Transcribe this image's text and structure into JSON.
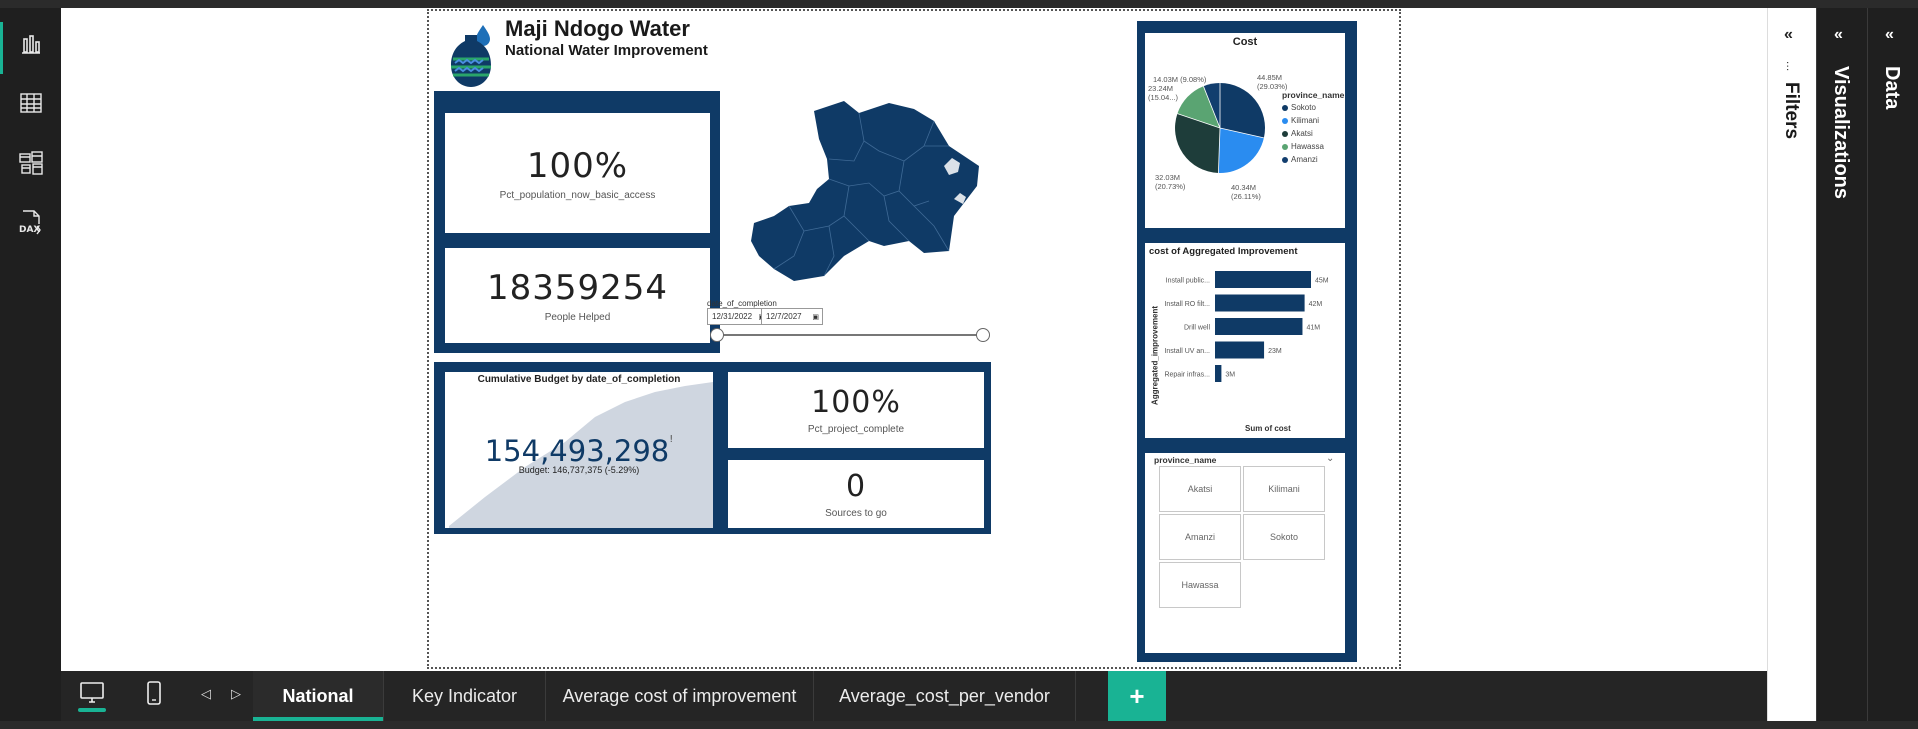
{
  "report": {
    "title": "Maji Ndogo Water",
    "subtitle": "National Water Improvement"
  },
  "kpis": {
    "pct_population": {
      "value": "100%",
      "label": "Pct_population_now_basic_access"
    },
    "people_helped": {
      "value": "18359254",
      "label": "People Helped"
    },
    "pct_project": {
      "value": "100%",
      "label": "Pct_project_complete"
    },
    "sources_to_go": {
      "value": "0",
      "label": "Sources to go"
    }
  },
  "date_slicer": {
    "label": "date_of_completion",
    "start": "12/31/2022",
    "end": "12/7/2027"
  },
  "cumulative": {
    "title": "Cumulative Budget by date_of_completion",
    "value": "154,493,298",
    "status_mark": "!",
    "budget_text": "Budget: 146,737,375 (-5.29%)"
  },
  "pie": {
    "title": "Cost",
    "legend_title": "province_name",
    "legend": [
      {
        "name": "Sokoto",
        "color": "#0f3a66"
      },
      {
        "name": "Kilimani",
        "color": "#2a8cf0"
      },
      {
        "name": "Akatsi",
        "color": "#1e3d3a"
      },
      {
        "name": "Hawassa",
        "color": "#5aa472"
      },
      {
        "name": "Amanzi",
        "color": "#123e6e"
      }
    ],
    "labels": {
      "top_right": [
        "44.85M",
        "(29.03%)"
      ],
      "bottom_right": [
        "40.34M",
        "(26.11%)"
      ],
      "bottom_left": [
        "32.03M",
        "(20.73%)"
      ],
      "left_a": "14.03M (9.08%)",
      "left_b": [
        "23.24M",
        "(15.04...)"
      ]
    }
  },
  "chart_data": {
    "type": "bar",
    "title": "cost of Aggregated Improvement",
    "ylabel": "Aggregated_improvement",
    "xlabel": "Sum of cost",
    "categories": [
      "Install public...",
      "Install RO filt...",
      "Drill well",
      "Install UV an...",
      "Repair infras..."
    ],
    "values": [
      45,
      42,
      41,
      23,
      3
    ],
    "data_labels": [
      "45M",
      "42M",
      "41M",
      "23M",
      "3M"
    ],
    "color": "#0f3a66",
    "xlim": [
      0,
      45
    ]
  },
  "province_slicer": {
    "title": "province_name",
    "items": [
      "Akatsi",
      "Kilimani",
      "Amanzi",
      "Sokoto",
      "Hawassa"
    ]
  },
  "panes": {
    "filters": "Filters",
    "visualizations": "Visualizations",
    "data": "Data"
  },
  "tabs": [
    {
      "label": "National",
      "active": true
    },
    {
      "label": "Key Indicator",
      "active": false
    },
    {
      "label": "Average cost of improvement",
      "active": false
    },
    {
      "label": "Average_cost_per_vendor",
      "active": false
    }
  ],
  "add_tab": "+",
  "colors": {
    "navy": "#0f3a66",
    "accent": "#19b394",
    "area": "#cfd6e0"
  }
}
